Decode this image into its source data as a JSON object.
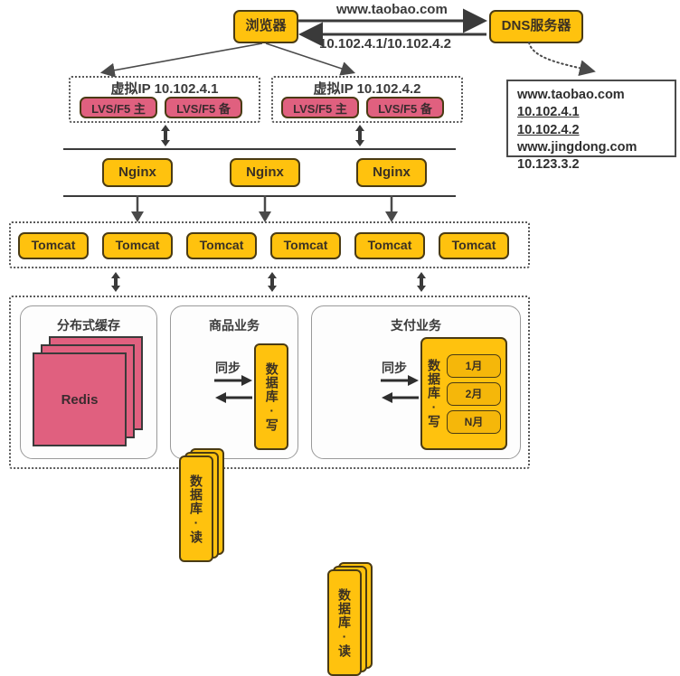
{
  "diagram": {
    "title": "Taobao high-availability architecture",
    "colors": {
      "amber": "#FFC20E",
      "pink": "#E0607F",
      "border_dark": "#4A3B14",
      "line": "#3A3A3A",
      "month_amber": "#F5B70A"
    },
    "top": {
      "browser": "浏览器",
      "dns_server": "DNS服务器",
      "request_label": "www.taobao.com",
      "response_label": "10.102.4.1/10.102.4.2"
    },
    "dns_table": {
      "rows": [
        {
          "text": "www.taobao.com",
          "underline": false
        },
        {
          "text": "10.102.4.1",
          "underline": true
        },
        {
          "text": "10.102.4.2",
          "underline": true
        },
        {
          "text": "www.jingdong.com",
          "underline": false
        },
        {
          "text": "10.123.3.2",
          "underline": false
        }
      ]
    },
    "vip_groups": [
      {
        "title": "虚拟IP 10.102.4.1",
        "nodes": [
          "LVS/F5 主",
          "LVS/F5 备"
        ]
      },
      {
        "title": "虚拟IP 10.102.4.2",
        "nodes": [
          "LVS/F5 主",
          "LVS/F5 备"
        ]
      }
    ],
    "nginx_layer": {
      "nodes": [
        "Nginx",
        "Nginx",
        "Nginx"
      ]
    },
    "tomcat_layer": {
      "nodes": [
        "Tomcat",
        "Tomcat",
        "Tomcat",
        "Tomcat",
        "Tomcat",
        "Tomcat"
      ]
    },
    "service_layer": {
      "cache_panel": {
        "title": "分布式缓存",
        "node": "Redis",
        "stack_count": 3
      },
      "product_panel": {
        "title": "商品业务",
        "read_db": "数据库·读",
        "write_db": "数据库·写",
        "sync_label": "同步",
        "read_stack_count": 3
      },
      "payment_panel": {
        "title": "支付业务",
        "read_db": "数据库·读",
        "write_db": "数据库·写",
        "sync_label": "同步",
        "read_stack_count": 3,
        "partitions": [
          "1月",
          "2月",
          "N月"
        ]
      }
    }
  }
}
